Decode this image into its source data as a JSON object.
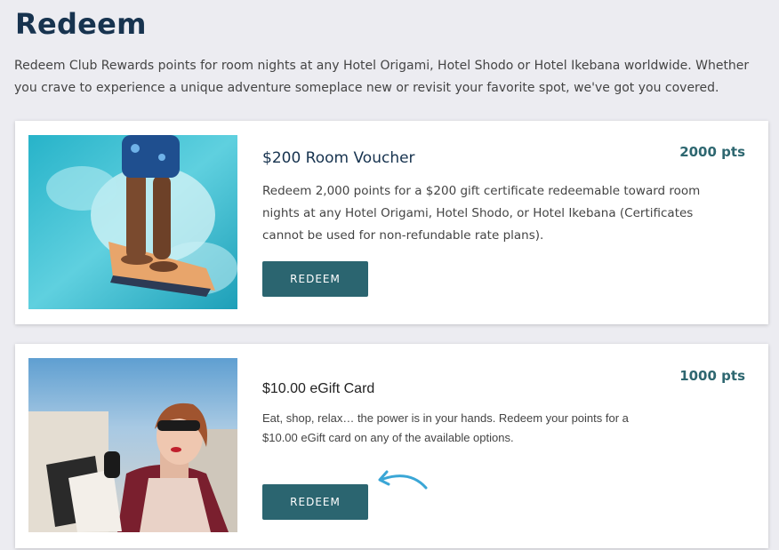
{
  "page": {
    "title": "Redeem",
    "intro": "Redeem Club Rewards points for room nights at any Hotel Origami, Hotel Shodo or Hotel Ikebana worldwide. Whether you crave to experience a unique adventure someplace new or revisit your favorite spot, we've got you covered."
  },
  "rewards": [
    {
      "title": "$200 Room Voucher",
      "points": "2000 pts",
      "description": "Redeem 2,000 points for a $200 gift certificate redeemable toward room nights at any Hotel Origami, Hotel Shodo, or Hotel Ikebana (Certificates cannot be used for non-refundable rate plans).",
      "button_label": "REDEEM",
      "image": "surfer-photo"
    },
    {
      "title": "$10.00 eGift Card",
      "points": "1000 pts",
      "description": "Eat, shop, relax… the power is in your hands. Redeem your points for a $10.00 eGift card on any of the available options.",
      "button_label": "REDEEM",
      "image": "shopper-photo"
    }
  ],
  "colors": {
    "background": "#ececf1",
    "title": "#17334f",
    "button": "#2b6570",
    "points": "#2e6770",
    "arrow": "#3aa6d6"
  },
  "icons": {
    "annotation_arrow": "curved-arrow-icon"
  }
}
